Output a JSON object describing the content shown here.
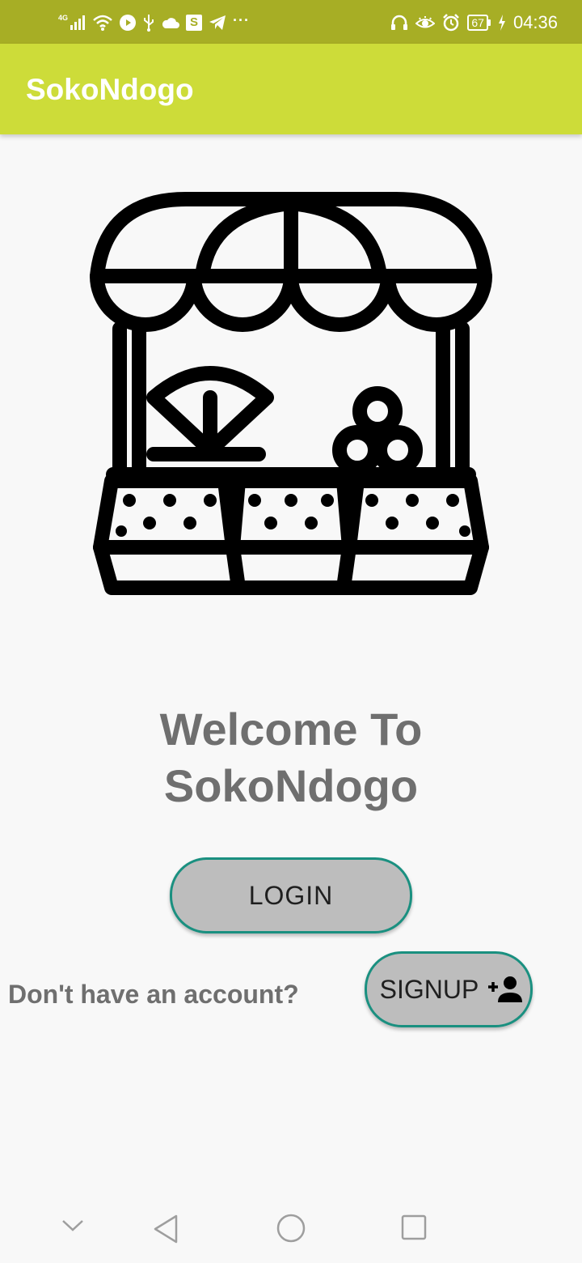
{
  "status_bar": {
    "network_tag": "4G",
    "s_badge": "S",
    "more": "···",
    "battery": "67",
    "time": "04:36"
  },
  "app_bar": {
    "title": "SokoNdogo"
  },
  "main": {
    "welcome_line1": "Welcome To",
    "welcome_line2": "SokoNdogo",
    "login_label": "LOGIN",
    "no_account_text": "Don't have an account?",
    "signup_label": "SIGNUP",
    "illustration_icon": "market-stall-icon",
    "signup_icon": "add-person-icon"
  },
  "nav_bar": {
    "icons": [
      "chevron-down-icon",
      "back-triangle-icon",
      "home-circle-icon",
      "recents-square-icon"
    ]
  },
  "colors": {
    "status_bar": "#a7ae25",
    "app_bar": "#cddc39",
    "button_fill": "#bdbdbd",
    "button_border": "#1a9080",
    "text_gray": "#6f6f6f",
    "background": "#f8f8f8"
  }
}
